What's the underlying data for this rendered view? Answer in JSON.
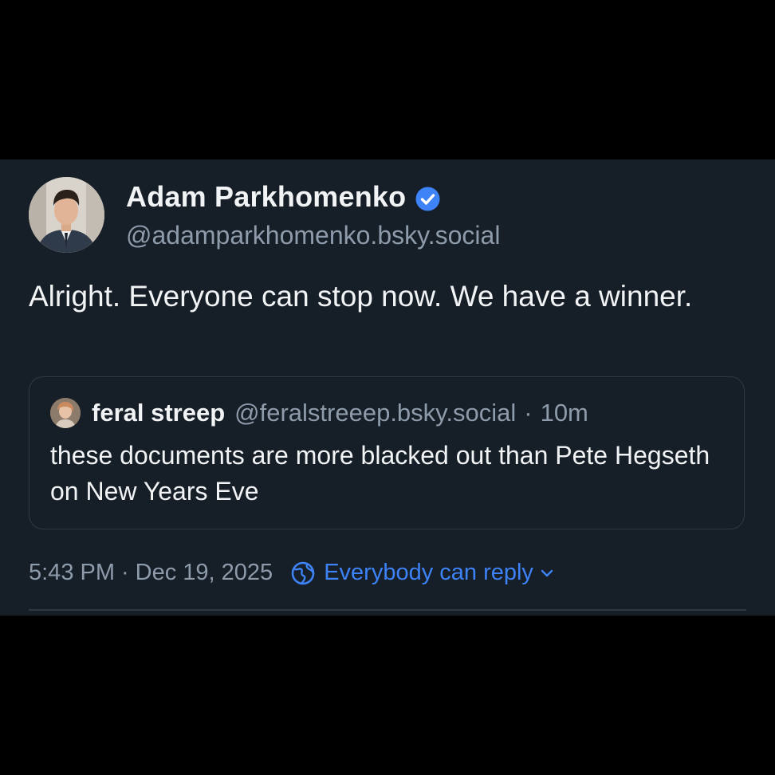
{
  "author": {
    "name": "Adam Parkhomenko",
    "handle": "@adamparkhomenko.bsky.social",
    "verified": true
  },
  "post": {
    "text": "Alright. Everyone can stop now. We have a winner."
  },
  "quote": {
    "name": "feral streep",
    "handle": "@feralstreeep.bsky.social",
    "separator": "·",
    "age": "10m",
    "text": "these documents are more blacked out than Pete Hegseth on New Years Eve"
  },
  "meta": {
    "time": "5:43 PM",
    "separator": "·",
    "date": "Dec 19, 2025",
    "reply_setting": "Everybody can reply"
  },
  "icons": {
    "verified": "verified-badge-icon",
    "reply_setting": "globe-icon",
    "dropdown": "chevron-down-icon"
  },
  "colors": {
    "background": "#000000",
    "card": "#161e27",
    "text": "#f1f3f5",
    "muted": "#8e9bab",
    "accent": "#3d82f6",
    "border": "#2e3a47"
  }
}
